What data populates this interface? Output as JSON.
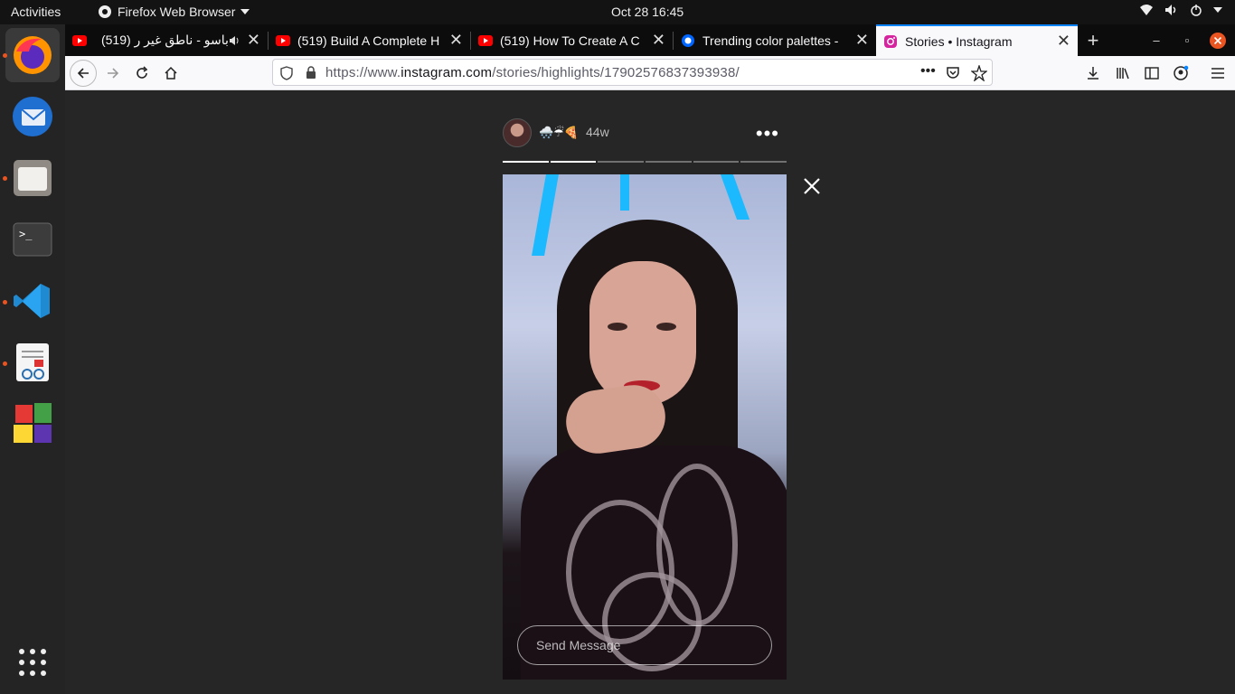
{
  "topbar": {
    "activities": "Activities",
    "app_name": "Firefox Web Browser",
    "clock": "Oct 28  16:45"
  },
  "tabs": [
    {
      "title": "باسو - ناطق غير ر (519)",
      "icon": "youtube-icon",
      "audio": true
    },
    {
      "title": "(519) Build A Complete H",
      "icon": "youtube-icon"
    },
    {
      "title": "(519) How To Create A C",
      "icon": "youtube-icon"
    },
    {
      "title": "Trending color palettes -",
      "icon": "coolors-icon"
    },
    {
      "title": "Stories • Instagram",
      "icon": "instagram-icon",
      "selected": true
    }
  ],
  "urlbar": {
    "prefix": "https://www.",
    "domain": "instagram.com",
    "path": "/stories/highlights/17902576837393938/"
  },
  "story": {
    "username": "🌨️☔🍕",
    "age": "44w",
    "segments_total": 6,
    "segments_done": 2,
    "reply_placeholder": "Send Message"
  },
  "colors": {
    "accent": "#0a84ff",
    "dock_running": "#e95420",
    "page_bg": "#262626"
  }
}
